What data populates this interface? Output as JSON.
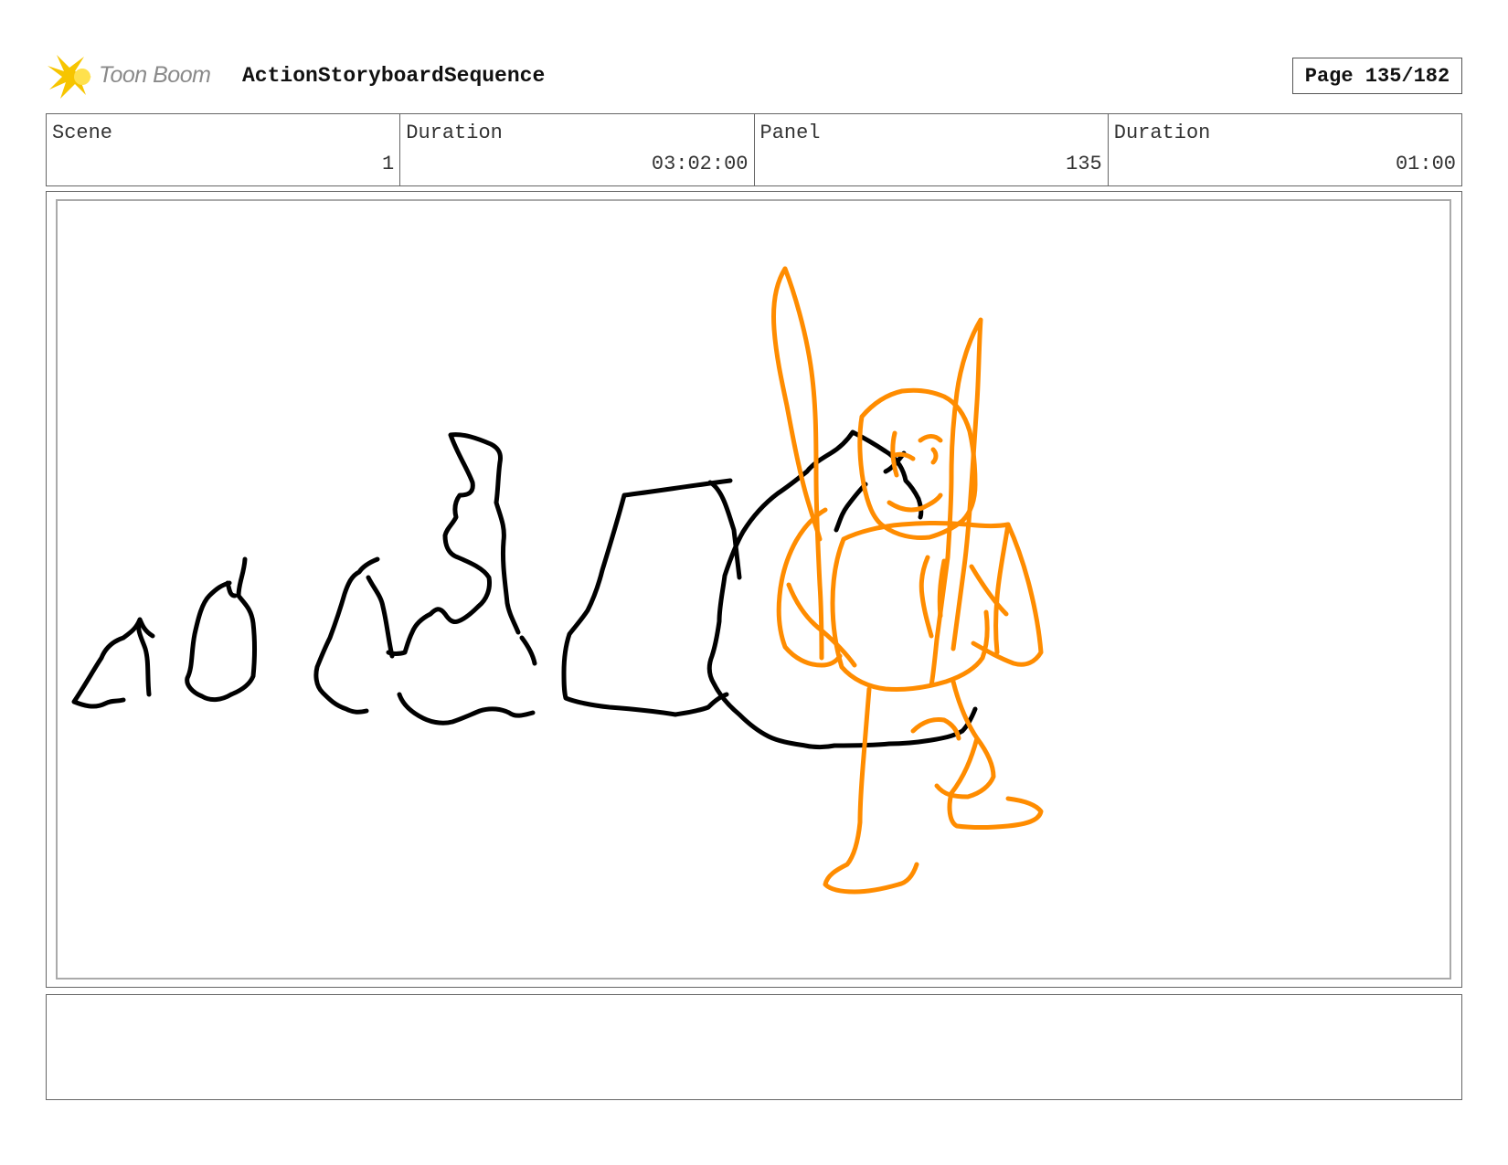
{
  "header": {
    "logo_text": "Toon Boom",
    "sequence_title": "ActionStoryboardSequence",
    "page_label": "Page 135/182"
  },
  "info": {
    "scene_label": "Scene",
    "scene_value": "1",
    "scene_duration_label": "Duration",
    "scene_duration_value": "03:02:00",
    "panel_label": "Panel",
    "panel_value": "135",
    "panel_duration_label": "Duration",
    "panel_duration_value": "01:00"
  },
  "drawing": {
    "rock_color": "#000000",
    "character_color": "#ff8c00"
  },
  "notes": {
    "text": ""
  },
  "colors": {
    "logo_star": "#f7c500",
    "border": "#666666"
  }
}
